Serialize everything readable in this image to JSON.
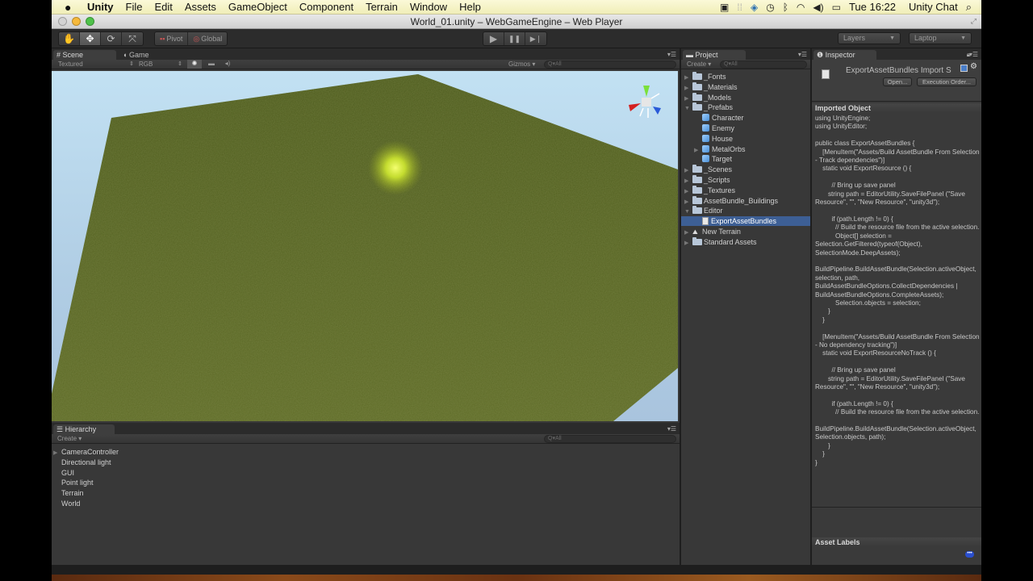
{
  "menubar": {
    "apple_icon": "apple-logo-icon",
    "app_name": "Unity",
    "menus": [
      "File",
      "Edit",
      "Assets",
      "GameObject",
      "Component",
      "Terrain",
      "Window",
      "Help"
    ],
    "tray_icons": [
      "screen-record-icon",
      "activity-icon",
      "user-switch-icon",
      "time-machine-icon",
      "bluetooth-icon",
      "wifi-icon",
      "volume-icon",
      "battery-icon"
    ],
    "clock": "Tue 16:22",
    "user": "Unity Chat",
    "spotlight_icon": "spotlight-search-icon"
  },
  "window": {
    "title": "World_01.unity – WebGameEngine – Web Player"
  },
  "toolbar": {
    "transform_tools": [
      {
        "name": "hand-tool",
        "glyph": "✋",
        "active": false
      },
      {
        "name": "move-tool",
        "glyph": "✥",
        "active": true
      },
      {
        "name": "rotate-tool",
        "glyph": "⟳",
        "active": false
      },
      {
        "name": "scale-tool",
        "glyph": "⤧",
        "active": false
      }
    ],
    "pivot_label": "Pivot",
    "global_label": "Global",
    "play_glyph": "▶",
    "pause_glyph": "❚❚",
    "step_glyph": "▶❘",
    "layers_label": "Layers",
    "layout_label": "Laptop"
  },
  "scene_panel": {
    "tabs": [
      {
        "label": "Scene",
        "icon": "scene-grid-icon",
        "active": true
      },
      {
        "label": "Game",
        "icon": "game-pacman-icon",
        "active": false
      }
    ],
    "render_mode": "Textured",
    "color_mode": "RGB",
    "lighting_icon": "sun-icon",
    "image_icon": "image-icon",
    "audio_icon": "audio-icon",
    "gizmos_label": "Gizmos",
    "search_placeholder": "Q▾All"
  },
  "hierarchy": {
    "tab_label": "Hierarchy",
    "create_label": "Create ▾",
    "search_placeholder": "Q▾All",
    "items": [
      {
        "label": "CameraController",
        "expandable": true
      },
      {
        "label": "Directional light",
        "expandable": false
      },
      {
        "label": "GUI",
        "expandable": false
      },
      {
        "label": "Point light",
        "expandable": false
      },
      {
        "label": "Terrain",
        "expandable": false
      },
      {
        "label": "World",
        "expandable": false
      }
    ]
  },
  "project": {
    "tab_label": "Project",
    "create_label": "Create ▾",
    "search_placeholder": "Q▾All",
    "items": [
      {
        "label": "_Fonts",
        "type": "folder",
        "depth": 0,
        "expanded": false
      },
      {
        "label": "_Materials",
        "type": "folder",
        "depth": 0,
        "expanded": false
      },
      {
        "label": "_Models",
        "type": "folder",
        "depth": 0,
        "expanded": false
      },
      {
        "label": "_Prefabs",
        "type": "folder",
        "depth": 0,
        "expanded": true
      },
      {
        "label": "Character",
        "type": "prefab",
        "depth": 1
      },
      {
        "label": "Enemy",
        "type": "prefab",
        "depth": 1
      },
      {
        "label": "House",
        "type": "prefab",
        "depth": 1
      },
      {
        "label": "MetalOrbs",
        "type": "prefab",
        "depth": 1,
        "expandable": true
      },
      {
        "label": "Target",
        "type": "prefab",
        "depth": 1
      },
      {
        "label": "_Scenes",
        "type": "folder",
        "depth": 0,
        "expanded": false
      },
      {
        "label": "_Scripts",
        "type": "folder",
        "depth": 0,
        "expanded": false
      },
      {
        "label": "_Textures",
        "type": "folder",
        "depth": 0,
        "expanded": false
      },
      {
        "label": "AssetBundle_Buildings",
        "type": "folder",
        "depth": 0,
        "expanded": false
      },
      {
        "label": "Editor",
        "type": "folder",
        "depth": 0,
        "expanded": true
      },
      {
        "label": "ExportAssetBundles",
        "type": "script",
        "depth": 1,
        "selected": true
      },
      {
        "label": "New Terrain",
        "type": "terrain",
        "depth": 0,
        "expanded": false
      },
      {
        "label": "Standard Assets",
        "type": "folder",
        "depth": 0,
        "expanded": false
      }
    ]
  },
  "inspector": {
    "tab_label": "Inspector",
    "title": "ExportAssetBundles Import S",
    "open_label": "Open...",
    "execution_order_label": "Execution Order...",
    "imported_object_header": "Imported Object",
    "code": "using UnityEngine;\nusing UnityEditor;\n\npublic class ExportAssetBundles {\n    [MenuItem(\"Assets/Build AssetBundle From Selection - Track dependencies\")]\n    static void ExportResource () {\n\n         // Bring up save panel\n       string path = EditorUtility.SaveFilePanel (\"Save Resource\", \"\", \"New Resource\", \"unity3d\");\n\n         if (path.Length != 0) {\n           // Build the resource file from the active selection.\n           Object[] selection = Selection.GetFiltered(typeof(Object), SelectionMode.DeepAssets);\n\nBuildPipeline.BuildAssetBundle(Selection.activeObject, selection, path, BuildAssetBundleOptions.CollectDependencies | BuildAssetBundleOptions.CompleteAssets);\n           Selection.objects = selection;\n       }\n    }\n\n    [MenuItem(\"Assets/Build AssetBundle From Selection - No dependency tracking\")]\n    static void ExportResourceNoTrack () {\n\n         // Bring up save panel\n       string path = EditorUtility.SaveFilePanel (\"Save Resource\", \"\", \"New Resource\", \"unity3d\");\n\n         if (path.Length != 0) {\n           // Build the resource file from the active selection.\n\nBuildPipeline.BuildAssetBundle(Selection.activeObject, Selection.objects, path);\n       }\n    }\n}",
    "asset_labels_header": "Asset Labels"
  }
}
